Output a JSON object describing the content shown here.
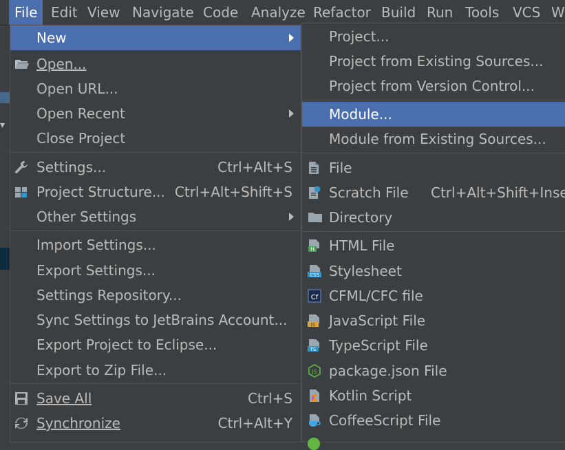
{
  "menubar": {
    "items": [
      "File",
      "Edit",
      "View",
      "Navigate",
      "Code",
      "Analyze",
      "Refactor",
      "Build",
      "Run",
      "Tools",
      "VCS",
      "W"
    ]
  },
  "file_menu": {
    "items": [
      {
        "label": "New",
        "submenu": true
      },
      {
        "label": "Open..."
      },
      {
        "label": "Open URL..."
      },
      {
        "label": "Open Recent",
        "submenu": true
      },
      {
        "label": "Close Project"
      },
      {
        "label": "Settings...",
        "shortcut": "Ctrl+Alt+S"
      },
      {
        "label": "Project Structure...",
        "shortcut": "Ctrl+Alt+Shift+S"
      },
      {
        "label": "Other Settings",
        "submenu": true
      },
      {
        "label": "Import Settings..."
      },
      {
        "label": "Export Settings..."
      },
      {
        "label": "Settings Repository..."
      },
      {
        "label": "Sync Settings to JetBrains Account..."
      },
      {
        "label": "Export Project to Eclipse..."
      },
      {
        "label": "Export to Zip File..."
      },
      {
        "label": "Save All",
        "shortcut": "Ctrl+S"
      },
      {
        "label": "Synchronize",
        "shortcut": "Ctrl+Alt+Y"
      }
    ]
  },
  "new_menu": {
    "items": [
      {
        "label": "Project..."
      },
      {
        "label": "Project from Existing Sources..."
      },
      {
        "label": "Project from Version Control..."
      },
      {
        "label": "Module..."
      },
      {
        "label": "Module from Existing Sources..."
      },
      {
        "label": "File",
        "icon": "file-icon"
      },
      {
        "label": "Scratch File",
        "shortcut": "Ctrl+Alt+Shift+Inser",
        "icon": "scratch-file-icon"
      },
      {
        "label": "Directory",
        "icon": "folder-icon"
      },
      {
        "label": "HTML File",
        "icon": "html-file-icon"
      },
      {
        "label": "Stylesheet",
        "icon": "css-file-icon"
      },
      {
        "label": "CFML/CFC file",
        "icon": "cfml-file-icon"
      },
      {
        "label": "JavaScript File",
        "icon": "js-file-icon"
      },
      {
        "label": "TypeScript File",
        "icon": "ts-file-icon"
      },
      {
        "label": "package.json File",
        "icon": "nodejs-icon"
      },
      {
        "label": "Kotlin Script",
        "icon": "kotlin-icon"
      },
      {
        "label": "CoffeeScript File",
        "icon": "coffeescript-icon"
      }
    ]
  },
  "colors": {
    "background": "#3c3f41",
    "highlight": "#4b6eaf",
    "text": "#bbbbbb",
    "separator": "#515151"
  }
}
